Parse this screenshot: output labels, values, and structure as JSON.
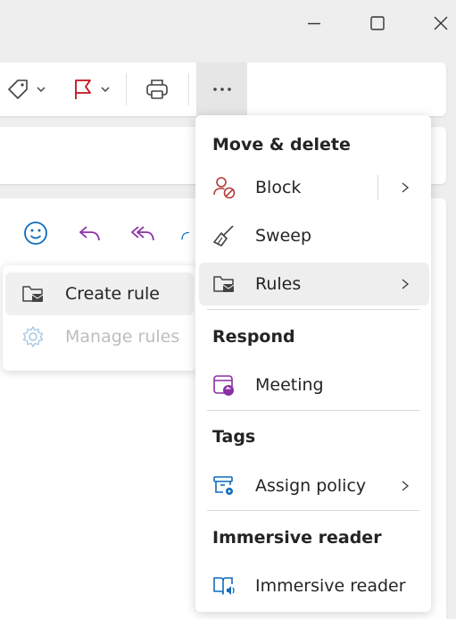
{
  "window": {
    "minimize_icon": "minimize-icon",
    "maximize_icon": "maximize-icon",
    "close_icon": "close-icon"
  },
  "toolbar": {
    "buttons": [
      "tag-icon",
      "flag-icon",
      "print-icon",
      "more-icon"
    ],
    "more_label": "···"
  },
  "actions": [
    "emoji-icon",
    "reply-icon",
    "reply-all-icon",
    "forward-icon"
  ],
  "rules_submenu": {
    "items": [
      {
        "label": "Create rule",
        "icon": "folder-rule-icon",
        "disabled": false
      },
      {
        "label": "Manage rules",
        "icon": "gear-icon",
        "disabled": true
      }
    ]
  },
  "more_menu": {
    "sections": [
      {
        "header": "Move & delete",
        "items": [
          {
            "label": "Block",
            "icon": "block-user-icon",
            "submenu": true
          },
          {
            "label": "Sweep",
            "icon": "sweep-broom-icon",
            "submenu": false
          },
          {
            "label": "Rules",
            "icon": "folder-rule-icon",
            "submenu": true
          }
        ]
      },
      {
        "header": "Respond",
        "items": [
          {
            "label": "Meeting",
            "icon": "meeting-calendar-icon",
            "submenu": false
          }
        ]
      },
      {
        "header": "Tags",
        "items": [
          {
            "label": "Assign policy",
            "icon": "assign-policy-icon",
            "submenu": true
          }
        ]
      },
      {
        "header": "Immersive reader",
        "items": [
          {
            "label": "Immersive reader",
            "icon": "immersive-reader-icon",
            "submenu": false
          }
        ]
      }
    ]
  },
  "colors": {
    "accent_blue": "#0f6cbd",
    "flag_red": "#c50f1f",
    "reply_purple": "#8a2fa6",
    "block_red": "#b33a3a",
    "disabled_text": "#bdbdbd"
  }
}
